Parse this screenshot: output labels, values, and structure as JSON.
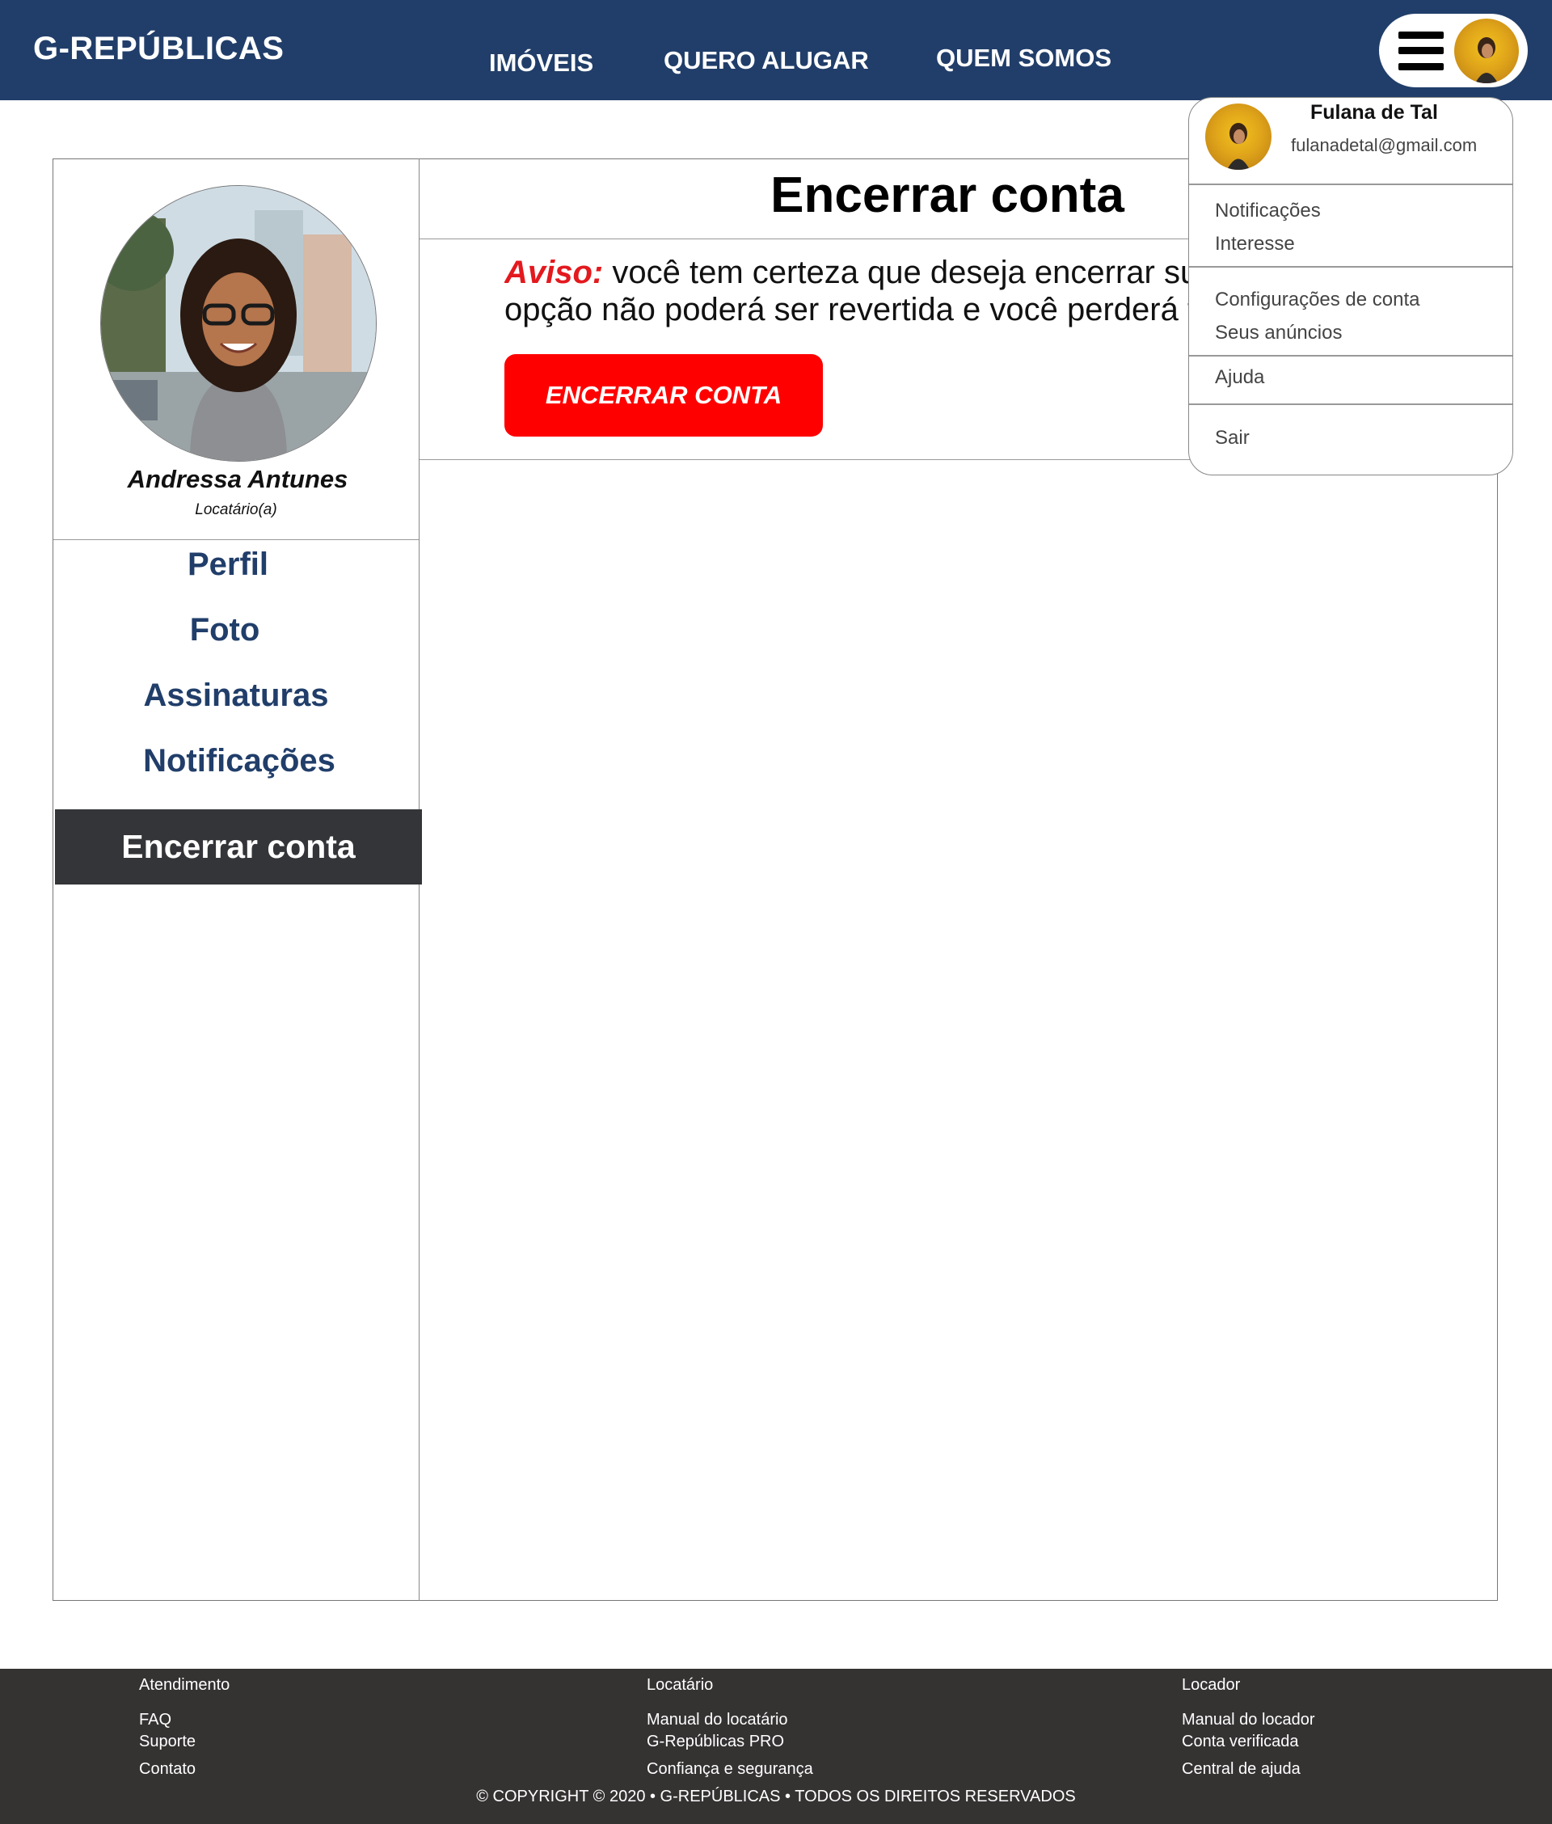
{
  "header": {
    "brand": "G-REPÚBLICAS",
    "nav": [
      "IMÓVEIS",
      "QUERO ALUGAR",
      "QUEM SOMOS"
    ],
    "colors": {
      "background": "#213e6a"
    }
  },
  "sidebar": {
    "profile_name": "Andressa Antunes",
    "profile_role": "Locatário(a)",
    "items": [
      "Perfil",
      "Foto",
      "Assinaturas",
      "Notificações"
    ],
    "active_item": "Encerrar conta"
  },
  "main": {
    "title": "Encerrar conta",
    "warning_label": "Aviso:",
    "warning_line1": " você tem certeza que deseja encerrar sua conta? Esta",
    "warning_line2": "opção não poderá ser revertida e você perderá todos os dados.",
    "button_label": "ENCERRAR CONTA",
    "colors": {
      "danger": "#ff0000",
      "warning_label": "#e3191e"
    }
  },
  "dropdown": {
    "user_name": "Fulana de Tal",
    "user_email": "fulanadetal@gmail.com",
    "items": [
      "Notificações",
      "Interesse",
      "Configurações de conta",
      "Seus anúncios",
      "Ajuda",
      "Sair"
    ]
  },
  "footer": {
    "columns": [
      {
        "heading": "Atendimento",
        "links": [
          "FAQ",
          "Suporte",
          "Contato"
        ]
      },
      {
        "heading": "Locatário",
        "links": [
          "Manual do locatário",
          "G-Repúblicas PRO",
          "Confiança e segurança"
        ]
      },
      {
        "heading": "Locador",
        "links": [
          "Manual do locador",
          "Conta verificada",
          "Central de ajuda"
        ]
      }
    ],
    "copyright": "© COPYRIGHT © 2020 • G-REPÚBLICAS • TODOS OS DIREITOS RESERVADOS",
    "colors": {
      "background": "#353232"
    }
  }
}
